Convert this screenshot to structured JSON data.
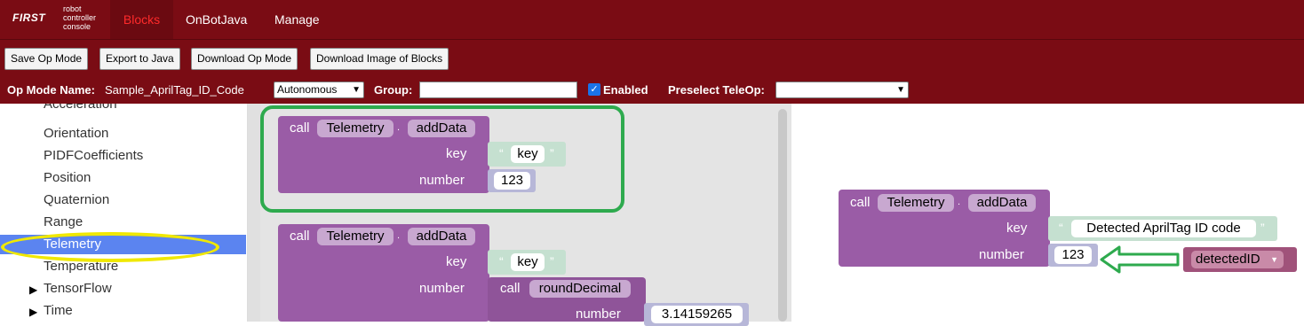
{
  "brand": {
    "first": "FIRST",
    "subtitle": "robot controller console"
  },
  "nav": {
    "tabs": [
      "Blocks",
      "OnBotJava",
      "Manage"
    ]
  },
  "toolbar": {
    "save": "Save Op Mode",
    "export": "Export to Java",
    "download": "Download Op Mode",
    "download_image": "Download Image of Blocks"
  },
  "opmode": {
    "name_label": "Op Mode Name:",
    "name_value": "Sample_AprilTag_ID_Code",
    "type_value": "Autonomous",
    "group_label": "Group:",
    "group_value": "",
    "enabled_label": "Enabled",
    "enabled": true,
    "preselect_label": "Preselect TeleOp:",
    "preselect_value": ""
  },
  "toolbox": {
    "items": [
      "Acceleration",
      "Orientation",
      "PIDFCoefficients",
      "Position",
      "Quaternion",
      "Range",
      "Telemetry",
      "Temperature",
      "TensorFlow",
      "Time"
    ],
    "selected": "Telemetry"
  },
  "blocks": {
    "call": "call",
    "class": "Telemetry",
    "dot": ".",
    "method": "addData",
    "key_label": "key",
    "number_label": "number",
    "key_value": "key",
    "number_value": "123",
    "round_call": "call",
    "round_method": "roundDecimal",
    "pi_value": "3.14159265",
    "ws_key_value": "Detected AprilTag ID code",
    "ws_number_value": "123",
    "ws_variable": "detectedID"
  },
  "colors": {
    "header": "#7a0c14",
    "block_purple": "#9a5ca6",
    "highlight_green": "#2eaa4e",
    "highlight_yellow": "#f0e800",
    "selected_blue": "#5b84f0"
  }
}
